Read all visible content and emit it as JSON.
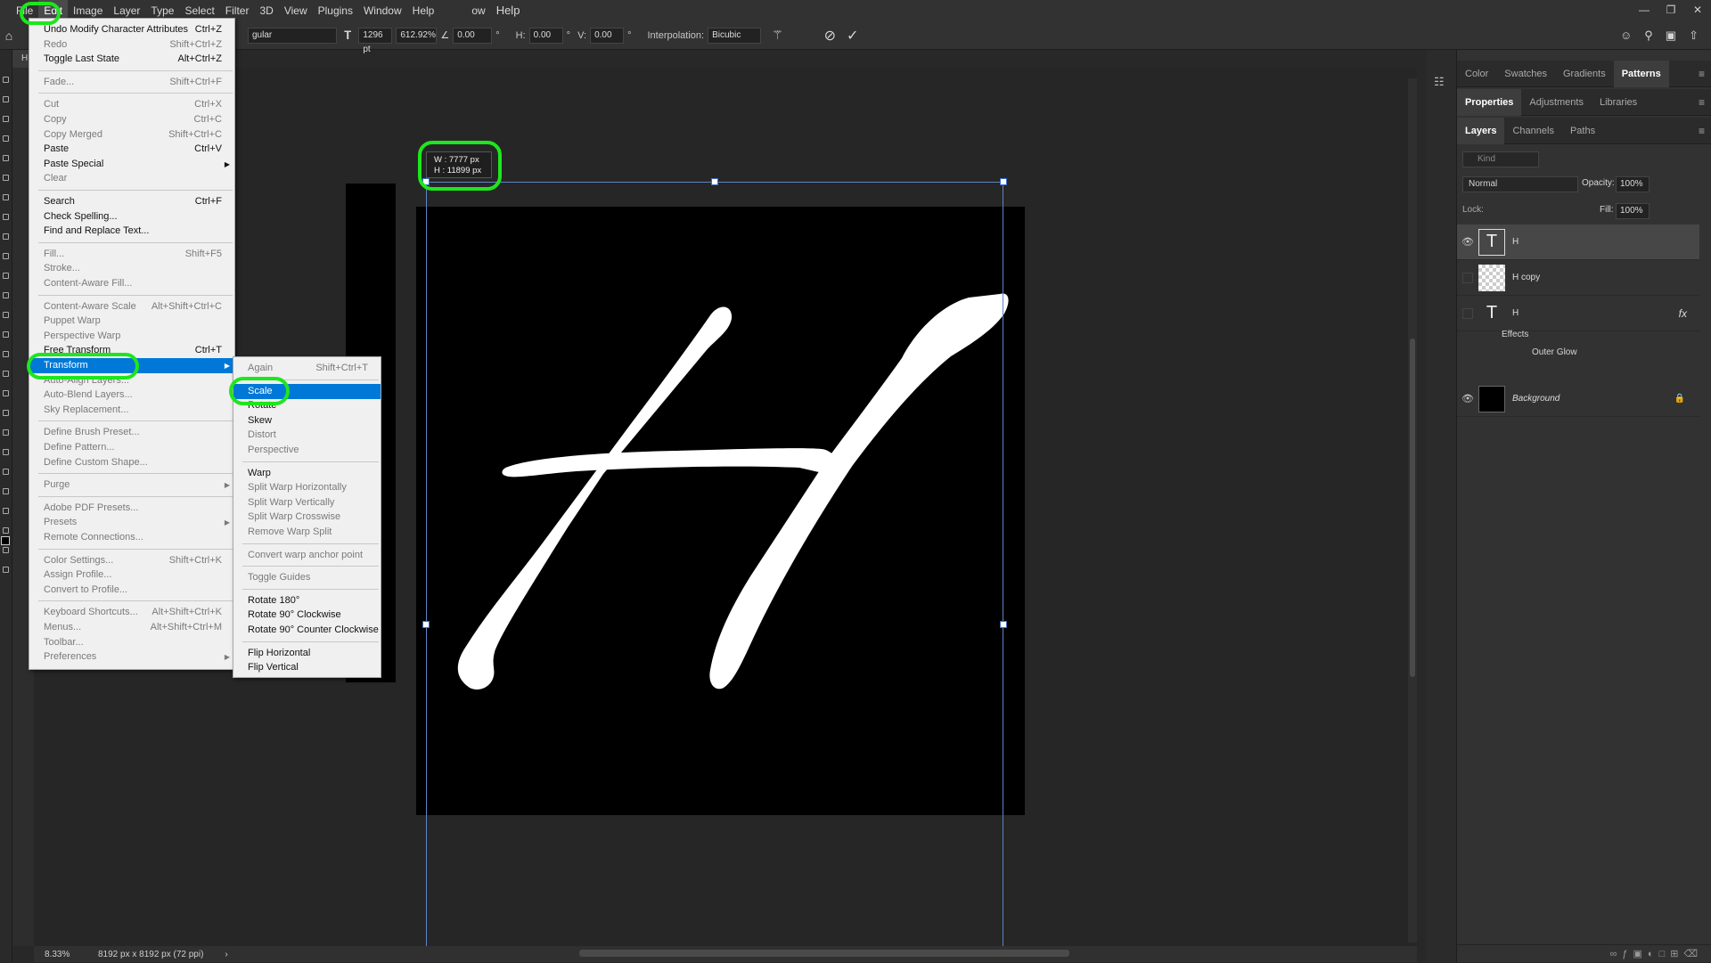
{
  "menubar": {
    "items": [
      "File",
      "Edit",
      "Image",
      "Layer",
      "Type",
      "Select",
      "Filter",
      "3D",
      "View",
      "Plugins",
      "Window",
      "Help"
    ],
    "active": "Edit",
    "extra_left": "ow",
    "extra_help": "Help"
  },
  "options": {
    "font_size": "1296 pt",
    "scale": "612.92%",
    "angle": "0.00",
    "h_label": "H:",
    "h_value": "0.00",
    "v_label": "V:",
    "v_value": "0.00",
    "interp_label": "Interpolation:",
    "interp_value": "Bicubic",
    "style_value": "gular",
    "deg": "°"
  },
  "dims": {
    "w": "W :   7777 px",
    "h": "H :  11899 px"
  },
  "status": {
    "zoom": "8.33%",
    "docsize": "8192 px x 8192 px (72 ppi)"
  },
  "edit_menu": [
    {
      "label": "Undo Modify Character Attributes",
      "shortcut": "Ctrl+Z",
      "disabled": false
    },
    {
      "label": "Redo",
      "shortcut": "Shift+Ctrl+Z",
      "disabled": true
    },
    {
      "label": "Toggle Last State",
      "shortcut": "Alt+Ctrl+Z",
      "disabled": false
    },
    {
      "sep": true
    },
    {
      "label": "Fade...",
      "shortcut": "Shift+Ctrl+F",
      "disabled": true
    },
    {
      "sep": true
    },
    {
      "label": "Cut",
      "shortcut": "Ctrl+X",
      "disabled": true
    },
    {
      "label": "Copy",
      "shortcut": "Ctrl+C",
      "disabled": true
    },
    {
      "label": "Copy Merged",
      "shortcut": "Shift+Ctrl+C",
      "disabled": true
    },
    {
      "label": "Paste",
      "shortcut": "Ctrl+V",
      "disabled": false
    },
    {
      "label": "Paste Special",
      "shortcut": "",
      "disabled": false,
      "sub": true
    },
    {
      "label": "Clear",
      "shortcut": "",
      "disabled": true
    },
    {
      "sep": true
    },
    {
      "label": "Search",
      "shortcut": "Ctrl+F",
      "disabled": false
    },
    {
      "label": "Check Spelling...",
      "shortcut": "",
      "disabled": false
    },
    {
      "label": "Find and Replace Text...",
      "shortcut": "",
      "disabled": false
    },
    {
      "sep": true
    },
    {
      "label": "Fill...",
      "shortcut": "Shift+F5",
      "disabled": true
    },
    {
      "label": "Stroke...",
      "shortcut": "",
      "disabled": true
    },
    {
      "label": "Content-Aware Fill...",
      "shortcut": "",
      "disabled": true
    },
    {
      "sep": true
    },
    {
      "label": "Content-Aware Scale",
      "shortcut": "Alt+Shift+Ctrl+C",
      "disabled": true
    },
    {
      "label": "Puppet Warp",
      "shortcut": "",
      "disabled": true
    },
    {
      "label": "Perspective Warp",
      "shortcut": "",
      "disabled": true
    },
    {
      "label": "Free Transform",
      "shortcut": "Ctrl+T",
      "disabled": false
    },
    {
      "label": "Transform",
      "shortcut": "",
      "disabled": false,
      "sub": true,
      "sel": true
    },
    {
      "label": "Auto-Align Layers...",
      "shortcut": "",
      "disabled": true
    },
    {
      "label": "Auto-Blend Layers...",
      "shortcut": "",
      "disabled": true
    },
    {
      "label": "Sky Replacement...",
      "shortcut": "",
      "disabled": true
    },
    {
      "sep": true
    },
    {
      "label": "Define Brush Preset...",
      "shortcut": "",
      "disabled": true
    },
    {
      "label": "Define Pattern...",
      "shortcut": "",
      "disabled": true
    },
    {
      "label": "Define Custom Shape...",
      "shortcut": "",
      "disabled": true
    },
    {
      "sep": true
    },
    {
      "label": "Purge",
      "shortcut": "",
      "disabled": true,
      "sub": true
    },
    {
      "sep": true
    },
    {
      "label": "Adobe PDF Presets...",
      "shortcut": "",
      "disabled": true
    },
    {
      "label": "Presets",
      "shortcut": "",
      "disabled": true,
      "sub": true
    },
    {
      "label": "Remote Connections...",
      "shortcut": "",
      "disabled": true
    },
    {
      "sep": true
    },
    {
      "label": "Color Settings...",
      "shortcut": "Shift+Ctrl+K",
      "disabled": true
    },
    {
      "label": "Assign Profile...",
      "shortcut": "",
      "disabled": true
    },
    {
      "label": "Convert to Profile...",
      "shortcut": "",
      "disabled": true
    },
    {
      "sep": true
    },
    {
      "label": "Keyboard Shortcuts...",
      "shortcut": "Alt+Shift+Ctrl+K",
      "disabled": true
    },
    {
      "label": "Menus...",
      "shortcut": "Alt+Shift+Ctrl+M",
      "disabled": true
    },
    {
      "label": "Toolbar...",
      "shortcut": "",
      "disabled": true
    },
    {
      "label": "Preferences",
      "shortcut": "",
      "disabled": true,
      "sub": true
    }
  ],
  "transform_menu": [
    {
      "label": "Again",
      "shortcut": "Shift+Ctrl+T",
      "disabled": true
    },
    {
      "sep": true
    },
    {
      "label": "Scale",
      "shortcut": "",
      "disabled": false,
      "sel": true
    },
    {
      "label": "Rotate",
      "shortcut": "",
      "disabled": false
    },
    {
      "label": "Skew",
      "shortcut": "",
      "disabled": false
    },
    {
      "label": "Distort",
      "shortcut": "",
      "disabled": true
    },
    {
      "label": "Perspective",
      "shortcut": "",
      "disabled": true
    },
    {
      "sep": true
    },
    {
      "label": "Warp",
      "shortcut": "",
      "disabled": false
    },
    {
      "label": "Split Warp Horizontally",
      "shortcut": "",
      "disabled": true
    },
    {
      "label": "Split Warp Vertically",
      "shortcut": "",
      "disabled": true
    },
    {
      "label": "Split Warp Crosswise",
      "shortcut": "",
      "disabled": true
    },
    {
      "label": "Remove Warp Split",
      "shortcut": "",
      "disabled": true
    },
    {
      "sep": true
    },
    {
      "label": "Convert warp anchor point",
      "shortcut": "",
      "disabled": true
    },
    {
      "sep": true
    },
    {
      "label": "Toggle Guides",
      "shortcut": "",
      "disabled": true
    },
    {
      "sep": true
    },
    {
      "label": "Rotate 180°",
      "shortcut": "",
      "disabled": false
    },
    {
      "label": "Rotate 90° Clockwise",
      "shortcut": "",
      "disabled": false
    },
    {
      "label": "Rotate 90° Counter Clockwise",
      "shortcut": "",
      "disabled": false
    },
    {
      "sep": true
    },
    {
      "label": "Flip Horizontal",
      "shortcut": "",
      "disabled": false
    },
    {
      "label": "Flip Vertical",
      "shortcut": "",
      "disabled": false
    }
  ],
  "panels": {
    "top_tabs": [
      "Color",
      "Swatches",
      "Gradients",
      "Patterns"
    ],
    "top_selected": "Patterns",
    "mid_tabs": [
      "Properties",
      "Adjustments",
      "Libraries"
    ],
    "mid_selected": "Properties",
    "layer_tabs": [
      "Layers",
      "Channels",
      "Paths"
    ],
    "layer_selected": "Layers",
    "kind": "Kind",
    "blend": "Normal",
    "opacity_label": "Opacity:",
    "opacity": "100%",
    "lock_label": "Lock:",
    "fill_label": "Fill:",
    "fill": "100%",
    "layers": [
      {
        "name": "H",
        "type": "text",
        "visible": true,
        "selected": true
      },
      {
        "name": "H copy",
        "type": "raster",
        "visible": false
      },
      {
        "name": "H",
        "type": "text",
        "visible": false,
        "fx": "fx"
      },
      {
        "name": "Background",
        "type": "bg",
        "visible": true,
        "locked": true
      }
    ],
    "effects_label": "Effects",
    "effect_item": "Outer Glow"
  },
  "colors": {
    "highlight": "#1ee61e",
    "menu_sel": "#0078d7",
    "bbox": "#5e84c9"
  }
}
